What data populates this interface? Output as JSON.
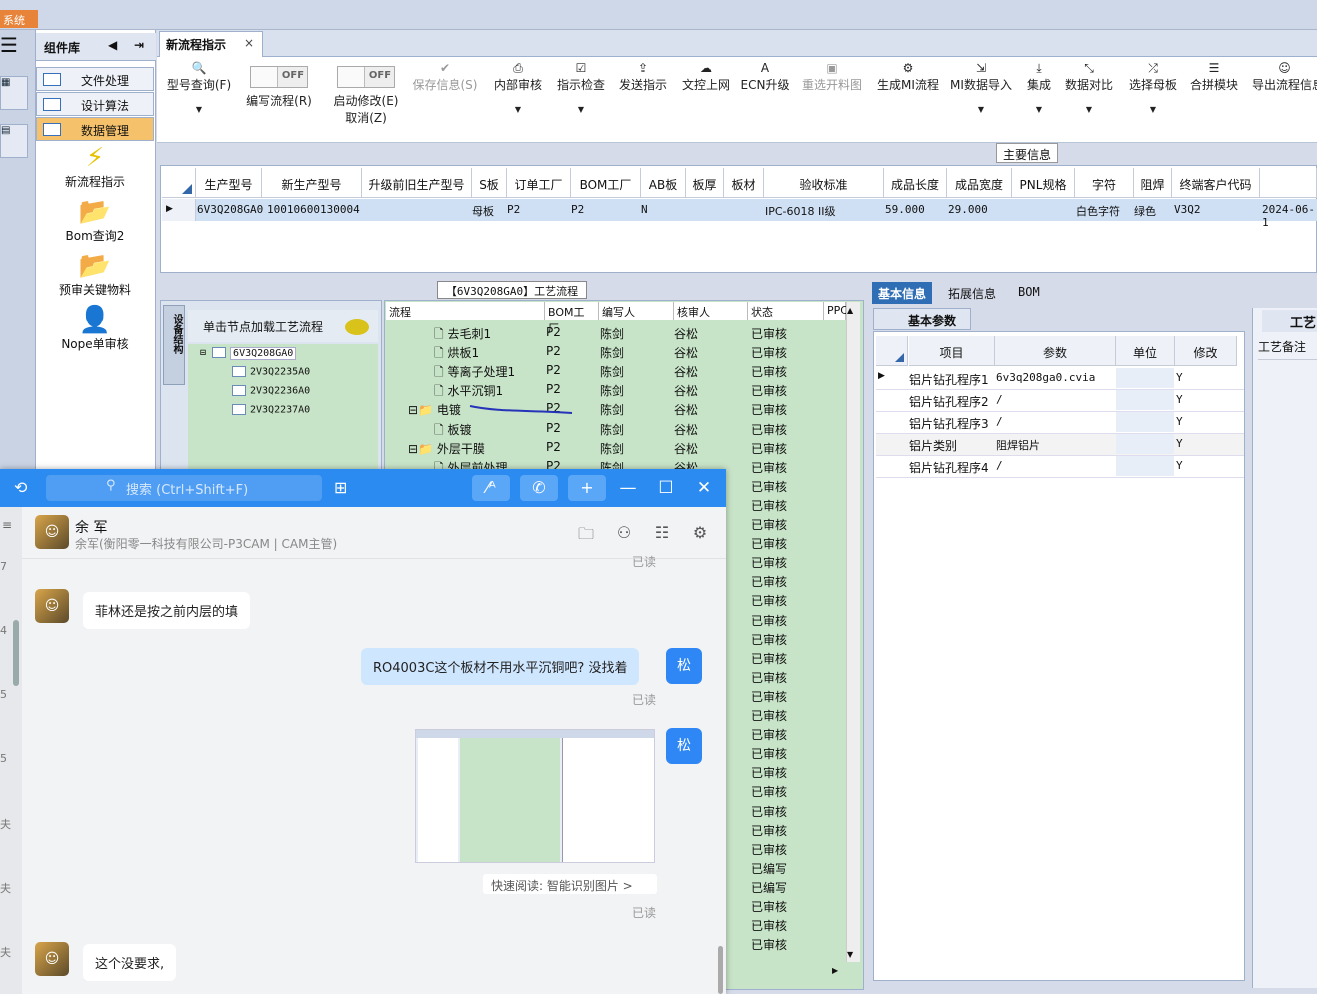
{
  "window": {
    "system_badge": "系统"
  },
  "tabs": {
    "main": "新流程指示",
    "close": "×"
  },
  "sidebar": {
    "title": "组件库",
    "nav_left": "◀",
    "nav_right": "⇥",
    "items": [
      {
        "label": "文件处理",
        "active": false
      },
      {
        "label": "设计算法",
        "active": false
      },
      {
        "label": "数据管理",
        "active": true
      }
    ],
    "tools": [
      {
        "label": "新流程指示",
        "icon": "lightning-icon"
      },
      {
        "label": "Bom查询2",
        "icon": "folder-icon"
      },
      {
        "label": "预审关键物料",
        "icon": "folder-icon"
      },
      {
        "label": "Nope单审核",
        "icon": "user-icon"
      }
    ]
  },
  "toolbar": {
    "buttons": [
      {
        "label": "型号查询(F)",
        "icon": "search-icon",
        "glyph": "🔍",
        "dropdown": true,
        "disabled": false
      },
      {
        "label": "编写流程(R)",
        "toggle": "OFF"
      },
      {
        "label": "启动修改(E)",
        "label2": "取消(Z)",
        "toggle": "OFF"
      },
      {
        "label": "保存信息(S)",
        "icon": "check-icon",
        "glyph": "✔",
        "disabled": true
      },
      {
        "label": "内部审核",
        "icon": "print-icon",
        "glyph": "⎙",
        "dropdown": true
      },
      {
        "label": "指示检查",
        "icon": "checkbox-icon",
        "glyph": "☑",
        "dropdown": true
      },
      {
        "label": "发送指示",
        "icon": "upload-icon",
        "glyph": "⇪"
      },
      {
        "label": "文控上网",
        "icon": "cloud-icon",
        "glyph": "☁"
      },
      {
        "label": "ECN升级",
        "icon": "ecn-icon",
        "glyph": "A"
      },
      {
        "label": "重选开料图",
        "icon": "image-icon",
        "glyph": "▣",
        "disabled": true
      },
      {
        "label": "生成MI流程",
        "icon": "gears-icon",
        "glyph": "⚙"
      },
      {
        "label": "MI数据导入",
        "icon": "import-icon",
        "glyph": "⇲",
        "dropdown": true
      },
      {
        "label": "集成",
        "icon": "download-icon",
        "glyph": "⤓",
        "dropdown": true
      },
      {
        "label": "数据对比",
        "icon": "compress-icon",
        "glyph": "⤡",
        "dropdown": true
      },
      {
        "label": "选择母板",
        "icon": "shuffle-icon",
        "glyph": "⤮",
        "dropdown": true
      },
      {
        "label": "合拼模块",
        "icon": "list-icon",
        "glyph": "☰"
      },
      {
        "label": "导出流程信息",
        "icon": "smile-icon",
        "glyph": "☺"
      }
    ]
  },
  "main_info": {
    "label": "主要信息",
    "headers": [
      "生产型号",
      "新生产型号",
      "升级前旧生产型号",
      "S板",
      "订单工厂",
      "BOM工厂",
      "AB板",
      "板厚",
      "板材",
      "验收标准",
      "成品长度",
      "成品宽度",
      "PNL规格",
      "字符",
      "阻焊",
      "终端客户代码",
      ""
    ],
    "row": [
      "6V3Q208GA0",
      "10010600130004",
      "",
      "母板",
      "P2",
      "P2",
      "N",
      "",
      "",
      "IPC-6018 II级",
      "59.000",
      "29.000",
      "",
      "白色字符",
      "绿色",
      "V3Q2",
      "2024-06-1"
    ]
  },
  "equipment": {
    "side_label": "设备结构",
    "hint": "单击节点加载工艺流程",
    "tree": [
      "6V3Q208GA0",
      "2V3Q2235A0",
      "2V3Q2236A0",
      "2V3Q2237A0"
    ]
  },
  "flow": {
    "title": "【6V3Q208GA0】工艺流程",
    "headers": [
      "流程",
      "BOM工厂",
      "编写人",
      "核审人",
      "状态",
      "PPC"
    ],
    "rows": [
      {
        "name": "去毛刺1",
        "bom": "P2",
        "writer": "陈剑",
        "reviewer": "谷松",
        "status": "已审核",
        "indent": 2
      },
      {
        "name": "烘板1",
        "bom": "P2",
        "writer": "陈剑",
        "reviewer": "谷松",
        "status": "已审核",
        "indent": 2
      },
      {
        "name": "等离子处理1",
        "bom": "P2",
        "writer": "陈剑",
        "reviewer": "谷松",
        "status": "已审核",
        "indent": 2
      },
      {
        "name": "水平沉铜1",
        "bom": "P2",
        "writer": "陈剑",
        "reviewer": "谷松",
        "status": "已审核",
        "indent": 2
      },
      {
        "name": "电镀",
        "bom": "P2",
        "writer": "陈剑",
        "reviewer": "谷松",
        "status": "已审核",
        "indent": 1,
        "folder": true
      },
      {
        "name": "板镀",
        "bom": "P2",
        "writer": "陈剑",
        "reviewer": "谷松",
        "status": "已审核",
        "indent": 2
      },
      {
        "name": "外层干膜",
        "bom": "P2",
        "writer": "陈剑",
        "reviewer": "谷松",
        "status": "已审核",
        "indent": 1,
        "folder": true
      },
      {
        "name": "外层前处理",
        "bom": "P2",
        "writer": "陈剑",
        "reviewer": "谷松",
        "status": "已审核",
        "indent": 2
      }
    ],
    "status_column": [
      "已审核",
      "已审核",
      "已审核",
      "已审核",
      "已审核",
      "已审核",
      "已审核",
      "已审核",
      "已审核",
      "已审核",
      "已审核",
      "已审核",
      "已审核",
      "已审核",
      "已审核",
      "已审核",
      "已审核",
      "已审核",
      "已审核",
      "已审核",
      "已审核",
      "已审核",
      "已审核",
      "已审核",
      "已审核",
      "已审核",
      "已审核",
      "已审核",
      "已编写",
      "已编写",
      "已审核",
      "已审核",
      "已审核"
    ]
  },
  "right": {
    "tabs": [
      "基本信息",
      "拓展信息",
      "BOM"
    ],
    "sub_tab": "基本参数",
    "far_tab": "工艺",
    "far_label": "工艺备注",
    "headers": [
      "项目",
      "参数",
      "单位",
      "修改"
    ],
    "rows": [
      {
        "item": "铝片钻孔程序1",
        "param": "6v3q208ga0.cvia",
        "unit": "",
        "mod": "Y"
      },
      {
        "item": "铝片钻孔程序2",
        "param": "/",
        "unit": "",
        "mod": "Y"
      },
      {
        "item": "铝片钻孔程序3",
        "param": "/",
        "unit": "",
        "mod": "Y"
      },
      {
        "item": "铝片类别",
        "param": "阻焊铝片",
        "unit": "",
        "mod": "Y"
      },
      {
        "item": "铝片钻孔程序4",
        "param": "/",
        "unit": "",
        "mod": "Y"
      }
    ]
  },
  "chat": {
    "search_placeholder": "搜索 (Ctrl+Shift+F)",
    "contact_name": "余 军",
    "contact_detail": "余军(衡阳零一科技有限公司-P3CAM | CAM主管)",
    "my_avatar": "松",
    "read_label": "已读",
    "messages": [
      {
        "from": "them",
        "text": "菲林还是按之前内层的填"
      },
      {
        "from": "me",
        "text": "RO4003C这个板材不用水平沉铜吧? 没找着"
      },
      {
        "from": "me",
        "image": true,
        "quick_read": "快速阅读: 智能识别图片 >"
      },
      {
        "from": "them",
        "text": "这个没要求,"
      }
    ],
    "left_strip_digits": [
      "7",
      "4",
      "5",
      "5",
      "夫",
      "夫",
      "夫"
    ]
  }
}
